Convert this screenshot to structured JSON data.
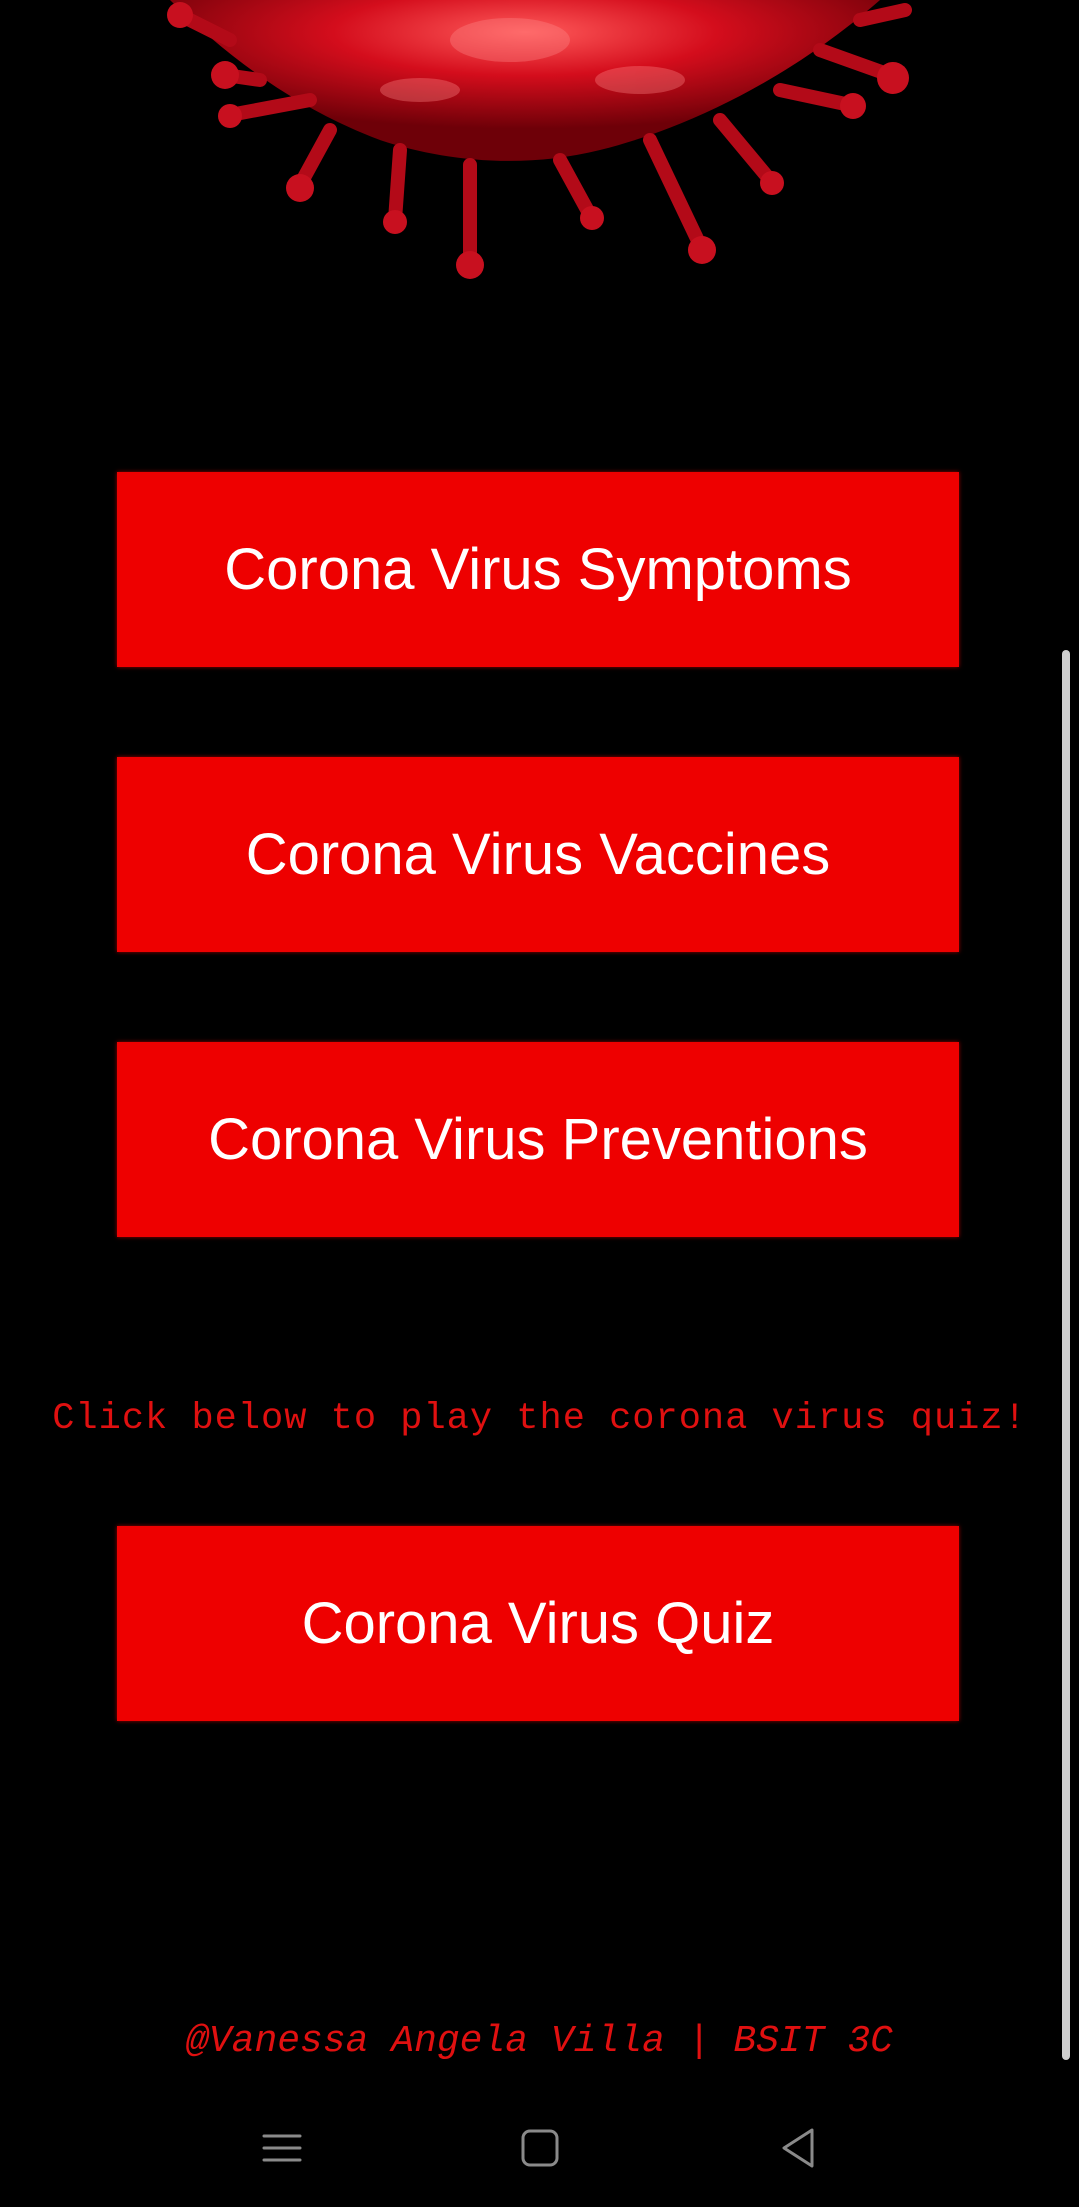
{
  "header": {
    "image": "corona-virus-graphic"
  },
  "menu": {
    "symptoms_label": "Corona Virus Symptoms",
    "vaccines_label": "Corona Virus Vaccines",
    "preventions_label": "Corona Virus Preventions"
  },
  "quiz": {
    "prompt": "Click below to play the corona virus quiz!",
    "button_label": "Corona Virus Quiz"
  },
  "footer": {
    "credit": "@Vanessa Angela Villa | BSIT 3C"
  },
  "nav": {
    "icons": [
      "menu-icon",
      "home-icon",
      "back-icon"
    ]
  },
  "colors": {
    "background": "#000000",
    "button": "#ee0000",
    "button_text": "#ffffff",
    "accent_text": "#e01010"
  }
}
